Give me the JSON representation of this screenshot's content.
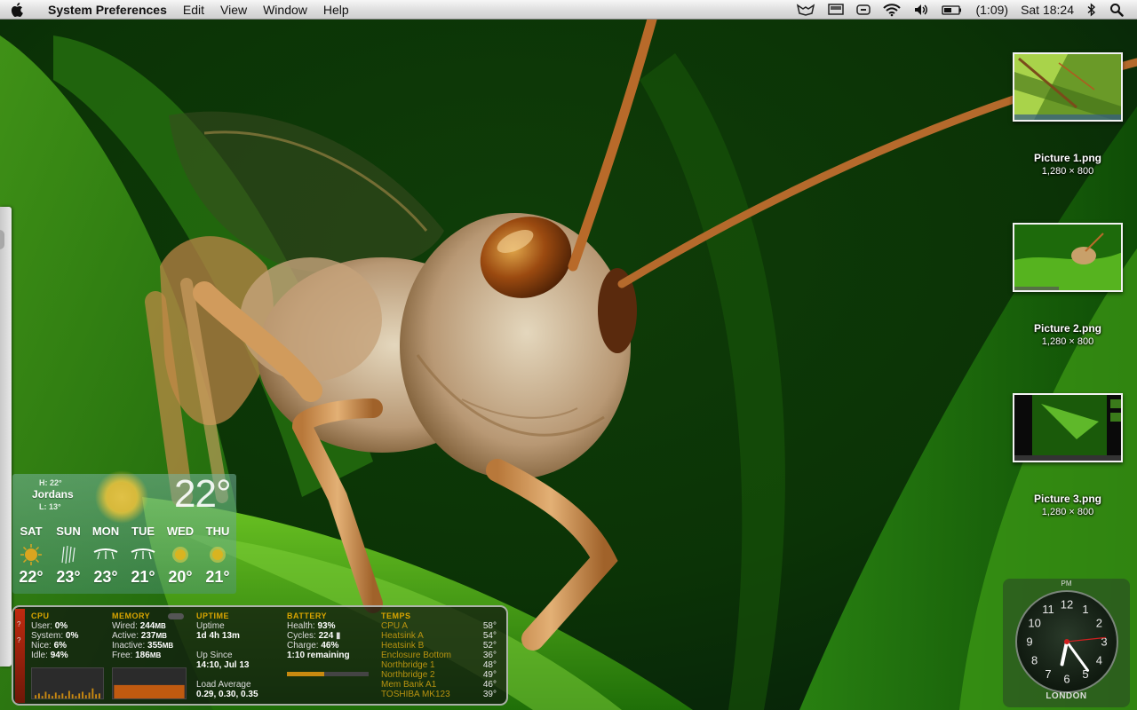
{
  "menubar": {
    "app_name": "System Preferences",
    "items": [
      "Edit",
      "View",
      "Window",
      "Help"
    ],
    "battery_time": "(1:09)",
    "clock": "Sat 18:24",
    "status_icons": [
      "growl-icon",
      "display-icon",
      "eject-icon",
      "wifi-icon",
      "volume-icon",
      "battery-icon",
      "bluetooth-icon",
      "spotlight-search-icon"
    ]
  },
  "desktop_files": [
    {
      "name": "Picture 1.png",
      "dimensions": "1,280 × 800"
    },
    {
      "name": "Picture 2.png",
      "dimensions": "1,280 × 800"
    },
    {
      "name": "Picture 3.png",
      "dimensions": "1,280 × 800"
    }
  ],
  "weather": {
    "high": "H: 22°",
    "city": "Jordans",
    "low": "L: 13°",
    "current_temp": "22°",
    "forecast": [
      {
        "day": "SAT",
        "temp": "22°",
        "icon": "sunny-icon"
      },
      {
        "day": "SUN",
        "temp": "23°",
        "icon": "rain-icon"
      },
      {
        "day": "MON",
        "temp": "23°",
        "icon": "windy-icon"
      },
      {
        "day": "TUE",
        "temp": "21°",
        "icon": "windy-icon"
      },
      {
        "day": "WED",
        "temp": "20°",
        "icon": "sunny-icon"
      },
      {
        "day": "THU",
        "temp": "21°",
        "icon": "sunny-icon"
      }
    ]
  },
  "istat": {
    "cpu": {
      "title": "CPU",
      "rows": [
        {
          "label": "User:",
          "value": "0%"
        },
        {
          "label": "System:",
          "value": "0%"
        },
        {
          "label": "Nice:",
          "value": "6%"
        },
        {
          "label": "Idle:",
          "value": "94%"
        }
      ]
    },
    "memory": {
      "title": "MEMORY",
      "rows": [
        {
          "label": "Wired:",
          "value": "244",
          "unit": "MB"
        },
        {
          "label": "Active:",
          "value": "237",
          "unit": "MB"
        },
        {
          "label": "Inactive:",
          "value": "355",
          "unit": "MB"
        },
        {
          "label": "Free:",
          "value": "186",
          "unit": "MB"
        }
      ]
    },
    "uptime": {
      "title": "UPTIME",
      "uptime_label": "Uptime",
      "uptime_value": "1d 4h 13m",
      "since_label": "Up Since",
      "since_value": "14:10, Jul 13",
      "load_label": "Load Average",
      "load_value": "0.29, 0.30, 0.35"
    },
    "battery": {
      "title": "BATTERY",
      "rows": [
        {
          "label": "Health:",
          "value": "93%"
        },
        {
          "label": "Cycles:",
          "value": "224"
        },
        {
          "label": "Charge:",
          "value": "46%"
        }
      ],
      "remaining": "1:10 remaining",
      "charge_fraction": 0.46
    },
    "temps": {
      "title": "TEMPS",
      "rows": [
        {
          "label": "CPU A",
          "value": "58°"
        },
        {
          "label": "Heatsink A",
          "value": "54°"
        },
        {
          "label": "Heatsink B",
          "value": "52°"
        },
        {
          "label": "Enclosure Bottom",
          "value": "36°"
        },
        {
          "label": "Northbridge 1",
          "value": "48°"
        },
        {
          "label": "Northbridge 2",
          "value": "49°"
        },
        {
          "label": "Mem Bank A1",
          "value": "46°"
        },
        {
          "label": "TOSHIBA MK123",
          "value": "39°"
        }
      ]
    }
  },
  "clock_widget": {
    "period": "PM",
    "city": "LONDON",
    "numbers": [
      "12",
      "1",
      "2",
      "3",
      "4",
      "5",
      "6",
      "7",
      "8",
      "9",
      "10",
      "11"
    ],
    "hour": 6,
    "minute": 24,
    "second": 14
  }
}
